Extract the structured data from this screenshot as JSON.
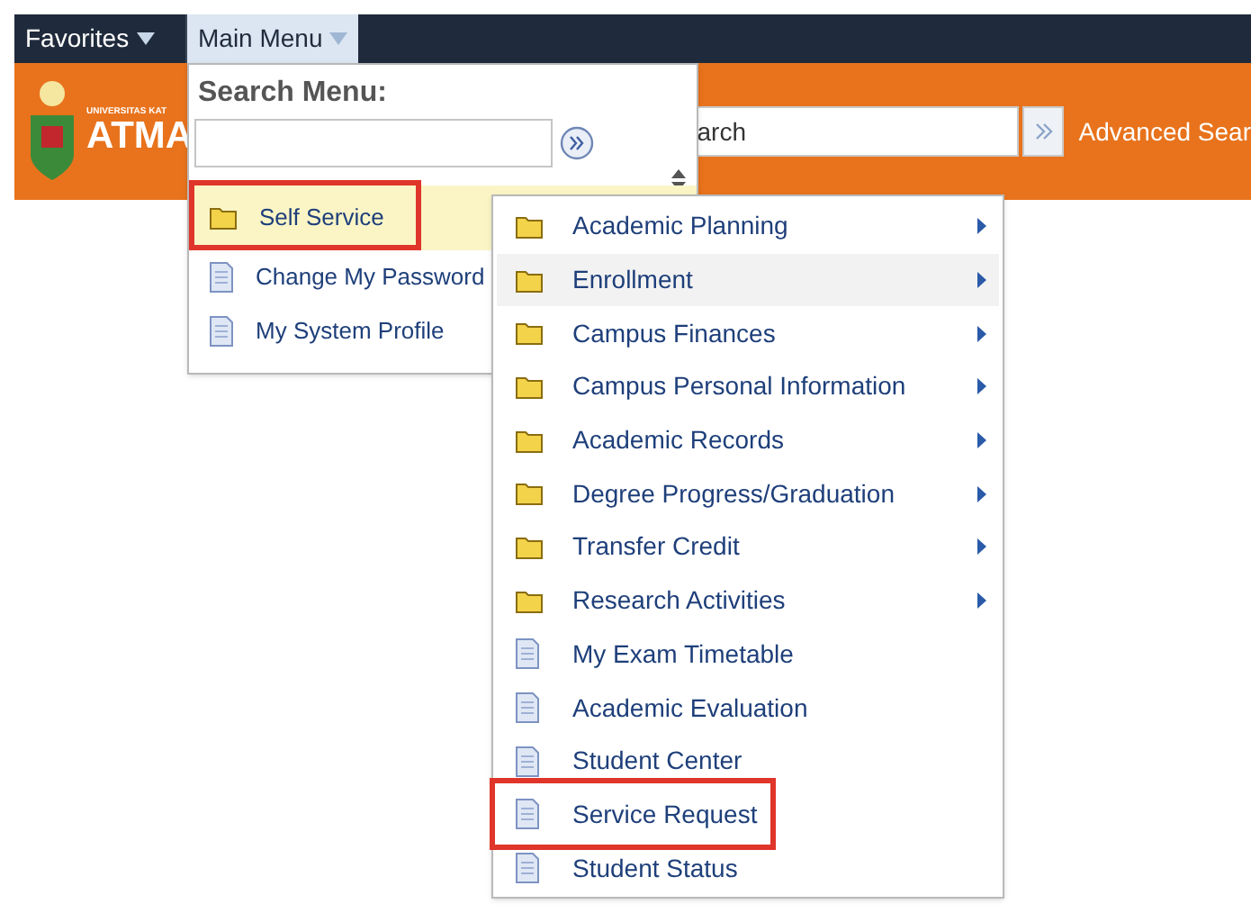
{
  "top_bar": {
    "tabs": [
      {
        "label": "Favorites",
        "selected": false
      },
      {
        "label": "Main Menu",
        "selected": true
      }
    ]
  },
  "banner": {
    "logo_small_text": "UNIVERSITAS KAT",
    "logo_text": "ATMA",
    "search": {
      "value": "arch"
    },
    "advanced_search": "Advanced Sear"
  },
  "main_menu": {
    "search_label": "Search Menu:",
    "items": [
      {
        "label": "Self Service",
        "kind": "folder",
        "selected": true,
        "highlighted": true
      },
      {
        "label": "Change My Password",
        "kind": "page",
        "selected": false,
        "highlighted": false
      },
      {
        "label": "My System Profile",
        "kind": "page",
        "selected": false,
        "highlighted": false
      }
    ]
  },
  "submenu": {
    "items": [
      {
        "label": "Academic Planning",
        "kind": "folder",
        "hovered": false,
        "highlighted": false
      },
      {
        "label": "Enrollment",
        "kind": "folder",
        "hovered": true,
        "highlighted": false
      },
      {
        "label": "Campus Finances",
        "kind": "folder",
        "hovered": false,
        "highlighted": false
      },
      {
        "label": "Campus Personal Information",
        "kind": "folder",
        "hovered": false,
        "highlighted": false
      },
      {
        "label": "Academic Records",
        "kind": "folder",
        "hovered": false,
        "highlighted": false
      },
      {
        "label": "Degree Progress/Graduation",
        "kind": "folder",
        "hovered": false,
        "highlighted": false
      },
      {
        "label": "Transfer Credit",
        "kind": "folder",
        "hovered": false,
        "highlighted": false
      },
      {
        "label": "Research Activities",
        "kind": "folder",
        "hovered": false,
        "highlighted": false
      },
      {
        "label": "My Exam Timetable",
        "kind": "page",
        "hovered": false,
        "highlighted": false
      },
      {
        "label": "Academic Evaluation",
        "kind": "page",
        "hovered": false,
        "highlighted": false
      },
      {
        "label": "Student Center",
        "kind": "page",
        "hovered": false,
        "highlighted": false
      },
      {
        "label": "Service Request",
        "kind": "page",
        "hovered": false,
        "highlighted": true
      },
      {
        "label": "Student Status",
        "kind": "page",
        "hovered": false,
        "highlighted": false
      }
    ]
  }
}
